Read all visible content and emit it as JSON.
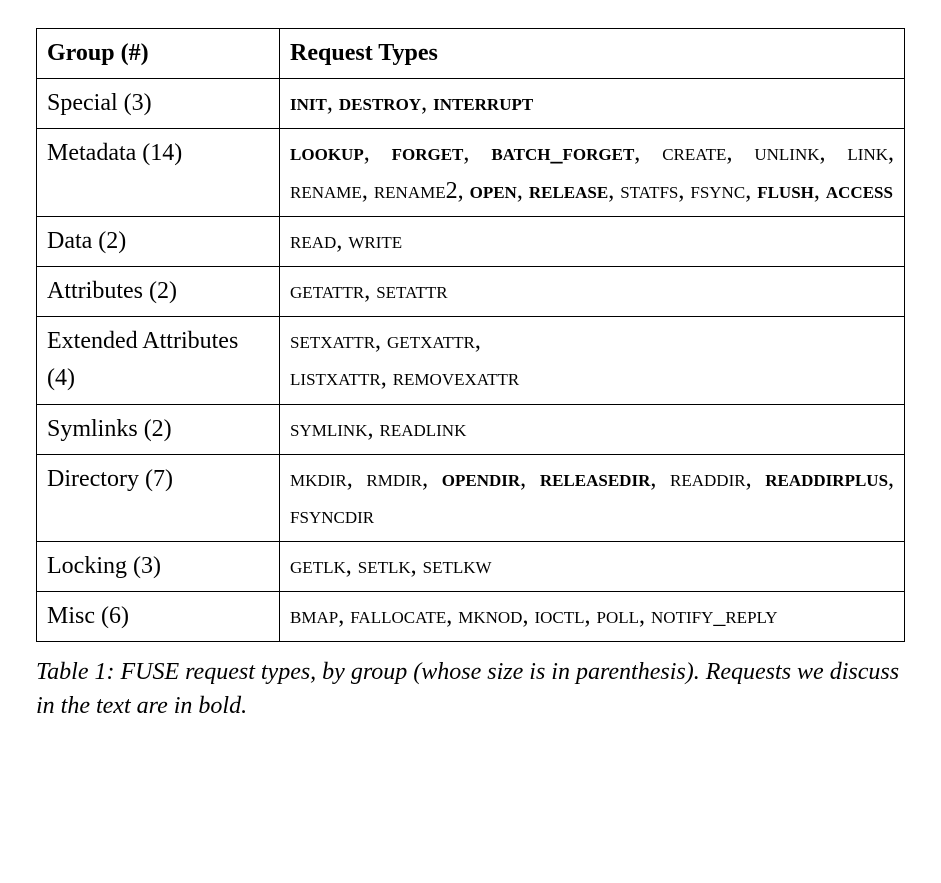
{
  "headers": {
    "group": "Group (#)",
    "types": "Request Types"
  },
  "rows": [
    {
      "group": "Special (3)",
      "types": [
        {
          "text": "init",
          "bold": true
        },
        {
          "text": ", "
        },
        {
          "text": "destroy",
          "bold": true
        },
        {
          "text": ", "
        },
        {
          "text": "interrupt",
          "bold": true
        }
      ],
      "justify": false
    },
    {
      "group": "Metadata (14)",
      "types": [
        {
          "text": "lookup",
          "bold": true
        },
        {
          "text": ", "
        },
        {
          "text": "forget",
          "bold": true
        },
        {
          "text": ", "
        },
        {
          "text": "batch_forget",
          "bold": true
        },
        {
          "text": ", "
        },
        {
          "text": "create"
        },
        {
          "text": ", "
        },
        {
          "text": "unlink"
        },
        {
          "text": ", "
        },
        {
          "text": "link"
        },
        {
          "text": ", "
        },
        {
          "text": "rename"
        },
        {
          "text": ", "
        },
        {
          "text": "rename"
        },
        {
          "text": "2",
          "digit": true
        },
        {
          "text": ", "
        },
        {
          "text": "open",
          "bold": true
        },
        {
          "text": ", "
        },
        {
          "text": "release",
          "bold": true
        },
        {
          "text": ", "
        },
        {
          "text": "statfs"
        },
        {
          "text": ", "
        },
        {
          "text": "fsync"
        },
        {
          "text": ", "
        },
        {
          "text": "flush",
          "bold": true
        },
        {
          "text": ", "
        },
        {
          "text": "access",
          "bold": true
        }
      ],
      "justify": true
    },
    {
      "group": "Data (2)",
      "types": [
        {
          "text": "read"
        },
        {
          "text": ", "
        },
        {
          "text": "write"
        }
      ],
      "justify": false
    },
    {
      "group": "Attributes (2)",
      "types": [
        {
          "text": "getattr"
        },
        {
          "text": ", "
        },
        {
          "text": "setattr"
        }
      ],
      "justify": false
    },
    {
      "group": "Extended Attributes (4)",
      "types": [
        {
          "text": "setxattr"
        },
        {
          "text": ", "
        },
        {
          "text": "getxattr"
        },
        {
          "text": ", "
        },
        {
          "text": "\n",
          "br": true
        },
        {
          "text": "listxattr"
        },
        {
          "text": ", "
        },
        {
          "text": "removexattr"
        }
      ],
      "justify": false
    },
    {
      "group": "Symlinks (2)",
      "types": [
        {
          "text": "symlink"
        },
        {
          "text": ", "
        },
        {
          "text": "readlink"
        }
      ],
      "justify": false
    },
    {
      "group": "Directory (7)",
      "types": [
        {
          "text": "mkdir"
        },
        {
          "text": ", "
        },
        {
          "text": "rmdir"
        },
        {
          "text": ", "
        },
        {
          "text": "opendir",
          "bold": true
        },
        {
          "text": ", "
        },
        {
          "text": "releasedir",
          "bold": true
        },
        {
          "text": ", "
        },
        {
          "text": "readdir"
        },
        {
          "text": ", "
        },
        {
          "text": "readdirplus",
          "bold": true
        },
        {
          "text": ", "
        },
        {
          "text": "fsyncdir"
        }
      ],
      "justify": true
    },
    {
      "group": "Locking (3)",
      "types": [
        {
          "text": "getlk"
        },
        {
          "text": ", "
        },
        {
          "text": "setlk"
        },
        {
          "text": ", "
        },
        {
          "text": "setlkw"
        }
      ],
      "justify": false
    },
    {
      "group": "Misc (6)",
      "types": [
        {
          "text": "bmap"
        },
        {
          "text": ", "
        },
        {
          "text": "fallocate"
        },
        {
          "text": ", "
        },
        {
          "text": "mknod"
        },
        {
          "text": ", "
        },
        {
          "text": "ioctl"
        },
        {
          "text": ", "
        },
        {
          "text": "poll"
        },
        {
          "text": ", "
        },
        {
          "text": "notify_reply"
        }
      ],
      "justify": true
    }
  ],
  "caption": "Table 1: FUSE request types, by group (whose size is in parenthesis). Requests we discuss in the text are in bold."
}
